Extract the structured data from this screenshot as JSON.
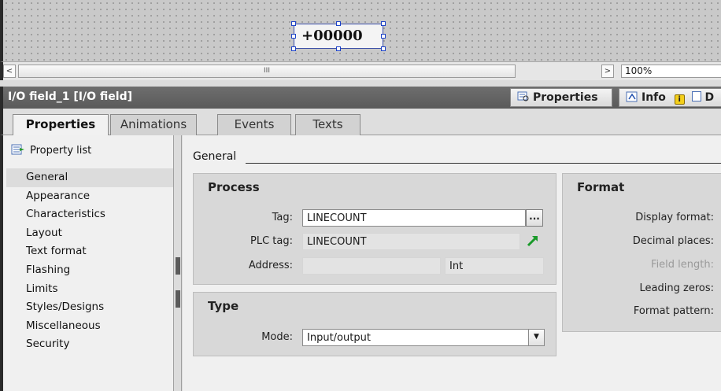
{
  "canvas": {
    "io_field_value": "+00000"
  },
  "hscroll": {
    "left_arrow": "<",
    "thumb_grip": "III",
    "right_arrow": ">",
    "zoom": "100%"
  },
  "inspector": {
    "title": "I/O field_1 [I/O field]",
    "tab_properties": "Properties",
    "tab_info": "Info",
    "tab_diag_partial": "D"
  },
  "tabs": [
    "Properties",
    "Animations",
    "Events",
    "Texts"
  ],
  "leftnav": {
    "property_list": "Property list",
    "items": [
      "General",
      "Appearance",
      "Characteristics",
      "Layout",
      "Text format",
      "Flashing",
      "Limits",
      "Styles/Designs",
      "Miscellaneous",
      "Security"
    ],
    "selected": "General"
  },
  "content": {
    "section": "General",
    "process": {
      "title": "Process",
      "tag_label": "Tag:",
      "tag_value": "LINECOUNT",
      "tag_button": "...",
      "plc_tag_label": "PLC tag:",
      "plc_tag_value": "LINECOUNT",
      "address_label": "Address:",
      "address_value": "",
      "address_type": "Int"
    },
    "type": {
      "title": "Type",
      "mode_label": "Mode:",
      "mode_value": "Input/output"
    },
    "format": {
      "title": "Format",
      "display_format_label": "Display format:",
      "decimal_places_label": "Decimal places:",
      "field_length_label": "Field length:",
      "leading_zeros_label": "Leading zeros:",
      "format_pattern_label": "Format pattern:"
    }
  },
  "colors": {
    "selection_border": "#1e43c8",
    "inspector_bar": "#626262",
    "plc_link_arrow": "#1a9a2a"
  }
}
